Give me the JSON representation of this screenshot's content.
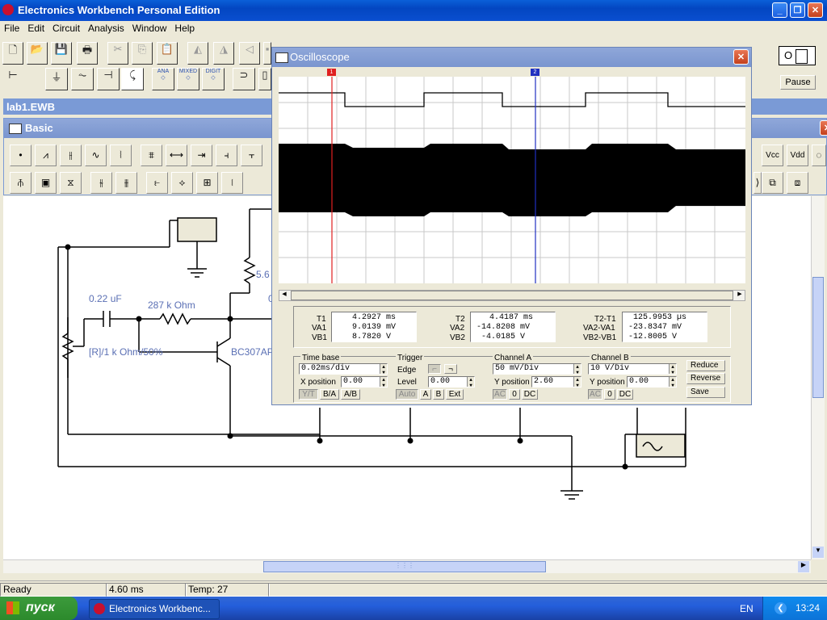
{
  "app": {
    "title": "Electronics Workbench Personal Edition"
  },
  "menu": [
    "File",
    "Edit",
    "Circuit",
    "Analysis",
    "Window",
    "Help"
  ],
  "power_switch": {
    "on": "I",
    "off": "O"
  },
  "pause_label": "Pause",
  "circuit_window": {
    "title": "lab1.EWB"
  },
  "parts_bin": {
    "title": "Basic",
    "row1_groups": [
      "ANA",
      "MIXED",
      "DIGIT"
    ],
    "right_labels": [
      "Vcc",
      "Vdd"
    ]
  },
  "circuit": {
    "capacitor_label": "0.22 uF",
    "resistor_label": "287 k Ohm",
    "pot_label": "[R]/1 k Ohm/50%",
    "transistor_label": "BC307AP",
    "collector_resistor_label": "5.6",
    "partial_label": "0"
  },
  "oscilloscope": {
    "title": "Oscilloscope",
    "cursor1": "1",
    "cursor2": "2",
    "readout": {
      "t1_label": "T1",
      "t1": "4.2927  ms",
      "va1_label": "VA1",
      "va1": "9.0139  mV",
      "vb1_label": "VB1",
      "vb1": "8.7820   V",
      "t2_label": "T2",
      "t2": "4.4187  ms",
      "va2_label": "VA2",
      "va2": "-14.8208  mV",
      "vb2_label": "VB2",
      "vb2": "-4.0185   V",
      "dt_label": "T2-T1",
      "dt": "125.9953  µs",
      "dva_label": "VA2-VA1",
      "dva": "-23.8347  mV",
      "dvb_label": "VB2-VB1",
      "dvb": "-12.8005   V"
    },
    "timebase": {
      "title": "Time base",
      "value": "0.02ms/div",
      "xpos_label": "X position",
      "xpos": "0.00",
      "modes": [
        "Y/T",
        "B/A",
        "A/B"
      ]
    },
    "trigger": {
      "title": "Trigger",
      "edge_label": "Edge",
      "level_label": "Level",
      "level": "0.00",
      "modes": [
        "Auto",
        "A",
        "B",
        "Ext"
      ]
    },
    "channel_a": {
      "title": "Channel A",
      "value": "50 mV/Div",
      "ypos_label": "Y position",
      "ypos": "2.60",
      "coupling": [
        "AC",
        "0",
        "DC"
      ]
    },
    "channel_b": {
      "title": "Channel B",
      "value": "10 V/Div",
      "ypos_label": "Y position",
      "ypos": "0.00",
      "coupling": [
        "AC",
        "0",
        "DC"
      ]
    },
    "buttons": {
      "reduce": "Reduce",
      "reverse": "Reverse",
      "save": "Save"
    }
  },
  "status": {
    "state": "Ready",
    "time": "4.60 ms",
    "temp": "Temp:  27"
  },
  "taskbar": {
    "start": "пуск",
    "task": "Electronics Workbenc...",
    "lang": "EN",
    "clock": "13:24"
  },
  "colors": {
    "xp_blue": "#0a4fd0",
    "inner_title": "#7a9ad6",
    "cursor1": "#e02020",
    "cursor2": "#2030c0",
    "label_blue": "#5a6fb4"
  }
}
